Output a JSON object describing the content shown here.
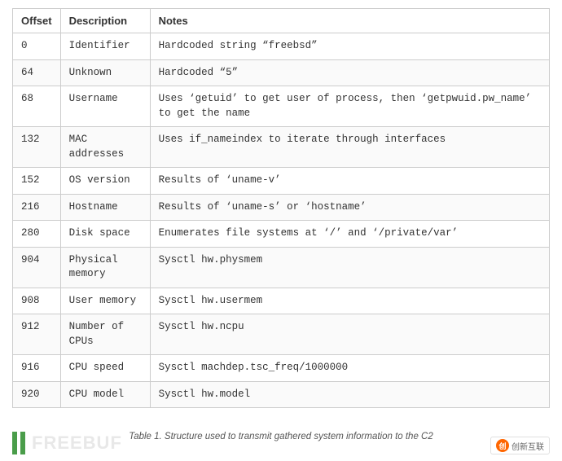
{
  "table": {
    "columns": [
      {
        "key": "offset",
        "label": "Offset"
      },
      {
        "key": "description",
        "label": "Description"
      },
      {
        "key": "notes",
        "label": "Notes"
      }
    ],
    "rows": [
      {
        "offset": "0",
        "description": "Identifier",
        "notes": "Hardcoded string “freebsd”"
      },
      {
        "offset": "64",
        "description": "Unknown",
        "notes": "Hardcoded “5”"
      },
      {
        "offset": "68",
        "description": "Username",
        "notes": "Uses ‘getuid’ to get user of process, then ‘getpwuid.pw_name’ to get the name"
      },
      {
        "offset": "132",
        "description": "MAC addresses",
        "notes": "Uses if_nameindex to iterate through interfaces"
      },
      {
        "offset": "152",
        "description": "OS version",
        "notes": "Results of ‘uname-v’"
      },
      {
        "offset": "216",
        "description": "Hostname",
        "notes": "Results of ‘uname-s’ or ‘hostname’"
      },
      {
        "offset": "280",
        "description": "Disk space",
        "notes": "Enumerates file systems at ‘/’ and ‘/private/var’"
      },
      {
        "offset": "904",
        "description": "Physical memory",
        "notes": "Sysctl hw.physmem"
      },
      {
        "offset": "908",
        "description": "User memory",
        "notes": "Sysctl hw.usermem"
      },
      {
        "offset": "912",
        "description": "Number of CPUs",
        "notes": "Sysctl hw.ncpu"
      },
      {
        "offset": "916",
        "description": "CPU speed",
        "notes": "Sysctl machdep.tsc_freq/1000000"
      },
      {
        "offset": "920",
        "description": "CPU model",
        "notes": "Sysctl hw.model"
      }
    ]
  },
  "footer": {
    "caption": "Table 1. Structure used to transmit gathered system information to the C2",
    "logo_left_text": "FREEBUF",
    "logo_right_text": "创新互联"
  }
}
